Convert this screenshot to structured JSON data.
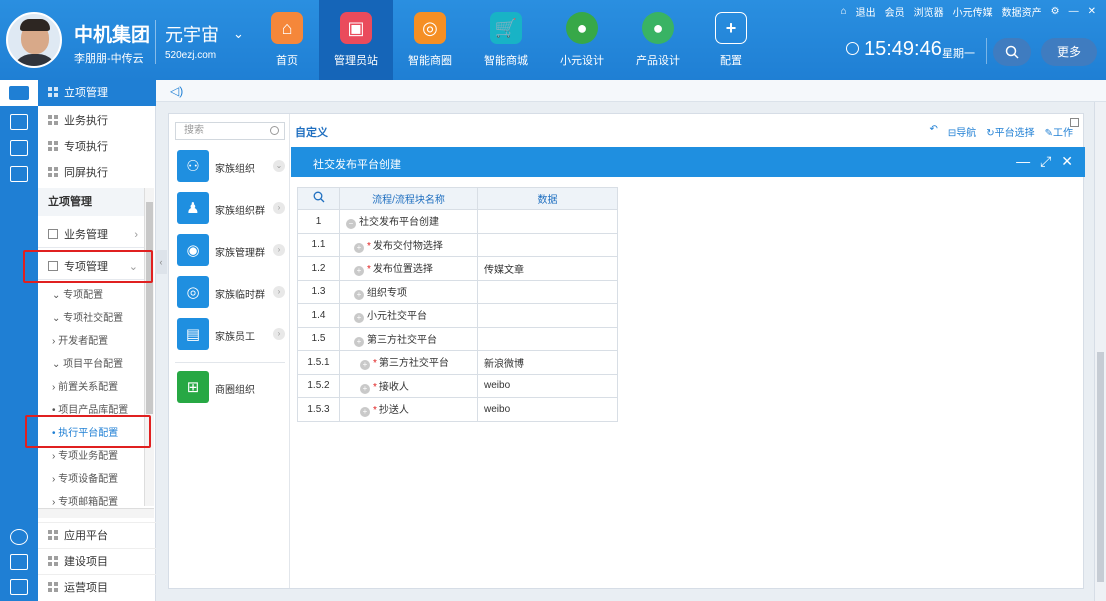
{
  "header": {
    "org_name": "中机集团",
    "user_name": "李朋朋-中传云",
    "brand": "元宇宙",
    "brand_sub": "520ezj.com",
    "nav": [
      {
        "label": "首页",
        "icon": "home-icon"
      },
      {
        "label": "管理员站",
        "icon": "monitor-icon",
        "active": true
      },
      {
        "label": "智能商圈",
        "icon": "circle-icon"
      },
      {
        "label": "智能商城",
        "icon": "cart-icon"
      },
      {
        "label": "小元设计",
        "icon": "xiaoyuan-icon"
      },
      {
        "label": "产品设计",
        "icon": "product-icon"
      },
      {
        "label": "配置",
        "icon": "plus-icon"
      }
    ],
    "top_links": [
      "退出",
      "会员",
      "浏览器",
      "小元传媒",
      "数据资产"
    ],
    "time": "15:49:46",
    "weekday": "星期一",
    "more_label": "更多"
  },
  "tree": {
    "head": "立项管理",
    "top_items": [
      "业务执行",
      "专项执行",
      "同屏执行"
    ],
    "section": "立项管理",
    "groups": [
      "业务管理",
      "专项管理"
    ],
    "subs": [
      "专项配置",
      "专项社交配置",
      "开发者配置",
      "项目平台配置",
      "前置关系配置",
      "项目产品库配置",
      "执行平台配置",
      "专项业务配置",
      "专项设备配置",
      "专项邮箱配置"
    ],
    "bottom_items": [
      "应用平台",
      "建设项目",
      "运营项目"
    ]
  },
  "family": {
    "search_placeholder": "搜索",
    "items": [
      "家族组织",
      "家族组织群",
      "家族管理群",
      "家族临时群",
      "家族员工",
      "商圈组织"
    ]
  },
  "custom": {
    "title": "自定义",
    "links": [
      "导航",
      "平台选择",
      "工作"
    ],
    "subbar_title": "社交发布平台创建"
  },
  "table": {
    "headers": [
      "流程/流程块名称",
      "数据"
    ],
    "rows": [
      {
        "num": "1",
        "name": "社交发布平台创建",
        "data": "",
        "required": false,
        "indent": 0
      },
      {
        "num": "1.1",
        "name": "发布交付物选择",
        "data": "",
        "required": true,
        "indent": 1
      },
      {
        "num": "1.2",
        "name": "发布位置选择",
        "data": "传媒文章",
        "required": true,
        "indent": 1
      },
      {
        "num": "1.3",
        "name": "组织专项",
        "data": "",
        "required": false,
        "indent": 1
      },
      {
        "num": "1.4",
        "name": "小元社交平台",
        "data": "",
        "required": false,
        "indent": 1
      },
      {
        "num": "1.5",
        "name": "第三方社交平台",
        "data": "",
        "required": false,
        "indent": 1
      },
      {
        "num": "1.5.1",
        "name": "第三方社交平台",
        "data": "新浪微博",
        "required": true,
        "indent": 2
      },
      {
        "num": "1.5.2",
        "name": "接收人",
        "data": "weibo",
        "required": true,
        "indent": 2
      },
      {
        "num": "1.5.3",
        "name": "抄送人",
        "data": "weibo",
        "required": true,
        "indent": 2
      }
    ]
  }
}
